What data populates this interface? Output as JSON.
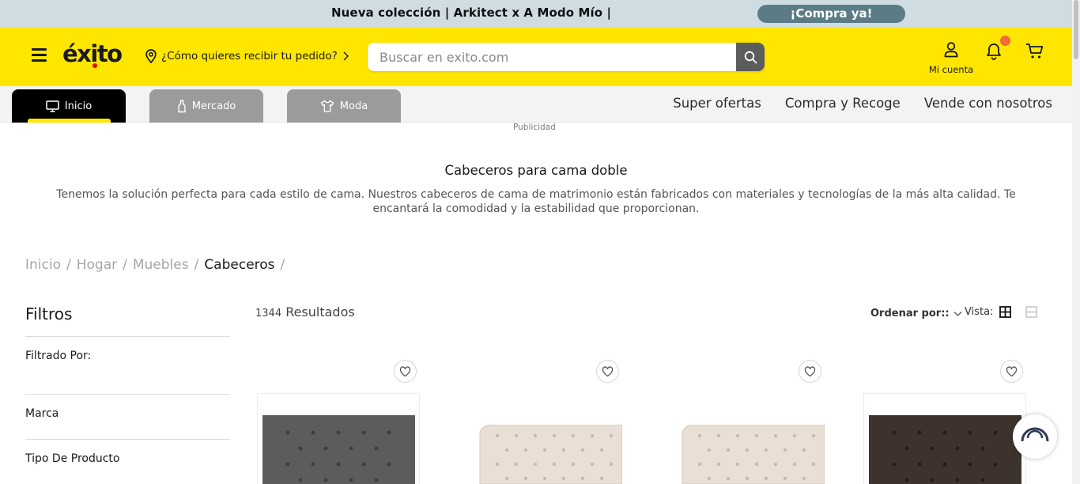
{
  "promo": {
    "text": "Nueva colección | Arkitect x A Modo Mío |",
    "cta": "¡Compra ya!"
  },
  "header": {
    "logo": "éxito",
    "location_prompt": "¿Cómo quieres recibir tu pedido?",
    "search_placeholder": "Buscar en exito.com",
    "account_label": "Mi cuenta"
  },
  "nav": {
    "tabs": [
      {
        "label": "Inicio",
        "icon": "monitor-icon"
      },
      {
        "label": "Mercado",
        "icon": "bottle-icon"
      },
      {
        "label": "Moda",
        "icon": "shirt-icon"
      }
    ],
    "links": [
      "Super ofertas",
      "Compra y Recoge",
      "Vende con nosotros"
    ]
  },
  "publicidad": "Publicidad",
  "category": {
    "title": "Cabeceros para cama doble",
    "description": "Tenemos la solución perfecta para cada estilo de cama. Nuestros cabeceros de cama de matrimonio están fabricados con materiales y tecnologías de la más alta calidad. Te encantará la comodidad y la estabilidad que proporcionan."
  },
  "breadcrumb": [
    "Inicio",
    "Hogar",
    "Muebles",
    "Cabeceros"
  ],
  "filters": {
    "title": "Filtros",
    "items": [
      "Filtrado Por:",
      "Marca",
      "Tipo De Producto"
    ]
  },
  "results": {
    "count": "1344",
    "label": "Resultados",
    "order_label": "Ordenar por::",
    "vista_label": "Vista:"
  },
  "products": [
    {
      "color": "#5a5a5a",
      "style": "gray-tufted"
    },
    {
      "color": "#e8ddd1",
      "style": "beige-tufted"
    },
    {
      "color": "#e8ddd1",
      "style": "beige-tufted"
    },
    {
      "color": "#3d322b",
      "style": "brown-tufted"
    }
  ],
  "colors": {
    "brand_yellow": "#ffe600",
    "promo_bg": "#cfdde3",
    "promo_button": "#5b7b87",
    "notification_dot": "#f26b3a"
  }
}
